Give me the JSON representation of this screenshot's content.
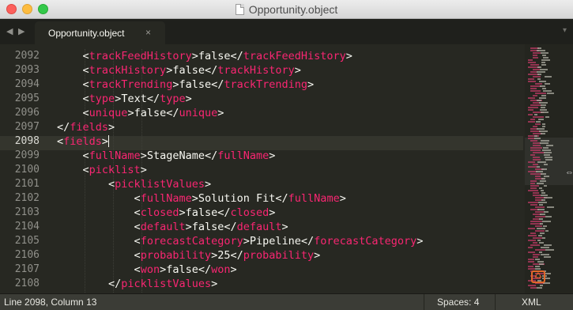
{
  "window": {
    "title": "Opportunity.object"
  },
  "tabbar": {
    "back_icon": "◀",
    "forward_icon": "▶",
    "tabs": [
      {
        "label": "Opportunity.object",
        "close": "×",
        "active": true
      }
    ],
    "dropdown_icon": "▾"
  },
  "editor": {
    "line_numbers": [
      "2092",
      "2093",
      "2094",
      "2095",
      "2096",
      "2097",
      "2098",
      "2099",
      "2100",
      "2101",
      "2102",
      "2103",
      "2104",
      "2105",
      "2106",
      "2107",
      "2108"
    ],
    "current_line": "2098",
    "lines": [
      {
        "indent": "    ",
        "open": "trackFeedHistory",
        "text": "false",
        "close": "trackFeedHistory"
      },
      {
        "indent": "    ",
        "open": "trackHistory",
        "text": "false",
        "close": "trackHistory"
      },
      {
        "indent": "    ",
        "open": "trackTrending",
        "text": "false",
        "close": "trackTrending"
      },
      {
        "indent": "    ",
        "open": "type",
        "text": "Text",
        "close": "type"
      },
      {
        "indent": "    ",
        "open": "unique",
        "text": "false",
        "close": "unique"
      },
      {
        "indent": "",
        "open": "",
        "text": "",
        "close": "fields"
      },
      {
        "indent": "",
        "open": "fields",
        "text": "",
        "close": ""
      },
      {
        "indent": "    ",
        "open": "fullName",
        "text": "StageName",
        "close": "fullName"
      },
      {
        "indent": "    ",
        "open": "picklist",
        "text": "",
        "close": ""
      },
      {
        "indent": "        ",
        "open": "picklistValues",
        "text": "",
        "close": ""
      },
      {
        "indent": "            ",
        "open": "fullName",
        "text": "Solution Fit",
        "close": "fullName"
      },
      {
        "indent": "            ",
        "open": "closed",
        "text": "false",
        "close": "closed"
      },
      {
        "indent": "            ",
        "open": "default",
        "text": "false",
        "close": "default"
      },
      {
        "indent": "            ",
        "open": "forecastCategory",
        "text": "Pipeline",
        "close": "forecastCategory"
      },
      {
        "indent": "            ",
        "open": "probability",
        "text": "25",
        "close": "probability"
      },
      {
        "indent": "            ",
        "open": "won",
        "text": "false",
        "close": "won"
      },
      {
        "indent": "        ",
        "open": "",
        "text": "",
        "close": "picklistValues"
      }
    ],
    "colors": {
      "background": "#272822",
      "tag": "#f92672",
      "text": "#f8f8f2",
      "line_number": "#90908a"
    }
  },
  "minimap": {
    "badge_icon": "sublime-plugin-icon",
    "badge_text": "♺"
  },
  "statusbar": {
    "position": "Line 2098, Column 13",
    "indentation": "Spaces: 4",
    "syntax": "XML"
  }
}
